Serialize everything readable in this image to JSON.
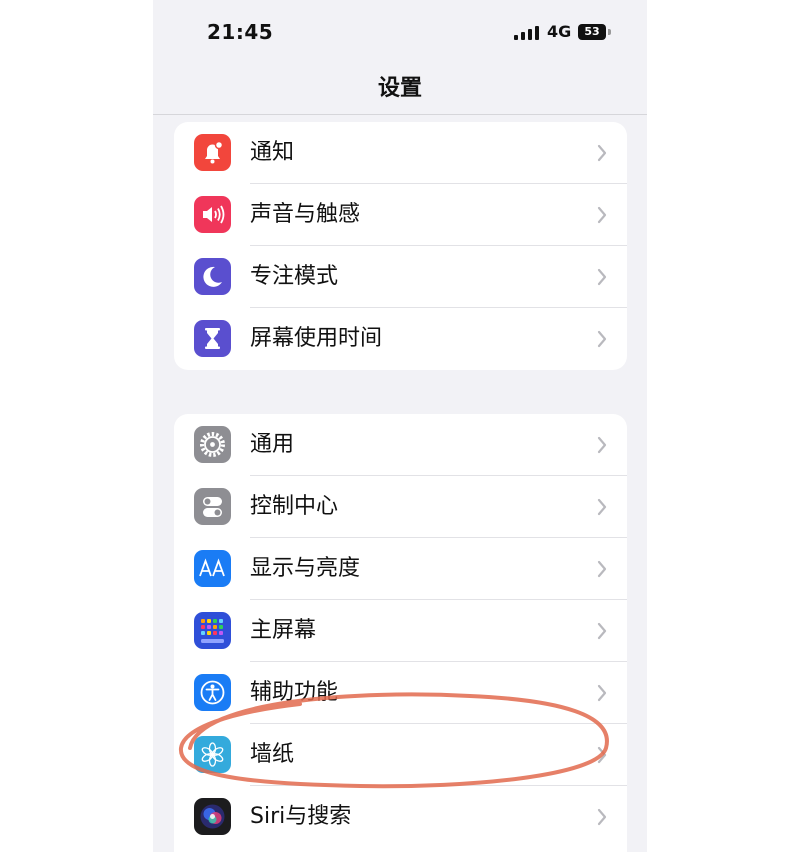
{
  "status_bar": {
    "time": "21:45",
    "network": "4G",
    "battery": "53"
  },
  "nav": {
    "title": "设置"
  },
  "groups": [
    {
      "items": [
        {
          "label": "通知",
          "icon": "notification-bell-icon",
          "color": "#f2463c"
        },
        {
          "label": "声音与触感",
          "icon": "speaker-icon",
          "color": "#f0365a"
        },
        {
          "label": "专注模式",
          "icon": "moon-icon",
          "color": "#5a4fcf"
        },
        {
          "label": "屏幕使用时间",
          "icon": "hourglass-icon",
          "color": "#5a4fcf"
        }
      ]
    },
    {
      "items": [
        {
          "label": "通用",
          "icon": "gear-icon",
          "color": "#8e8e93"
        },
        {
          "label": "控制中心",
          "icon": "toggles-icon",
          "color": "#8e8e93"
        },
        {
          "label": "显示与亮度",
          "icon": "text-size-icon",
          "color": "#1a7cf5"
        },
        {
          "label": "主屏幕",
          "icon": "home-screen-grid-icon",
          "color": "#2f4fd8"
        },
        {
          "label": "辅助功能",
          "icon": "accessibility-icon",
          "color": "#1a7cf5"
        },
        {
          "label": "墙纸",
          "icon": "flower-icon",
          "color": "#34aadc"
        },
        {
          "label": "Siri与搜索",
          "icon": "siri-icon",
          "color": "#1c1c1e"
        }
      ]
    }
  ],
  "annotation": {
    "color": "#e26a4e"
  }
}
